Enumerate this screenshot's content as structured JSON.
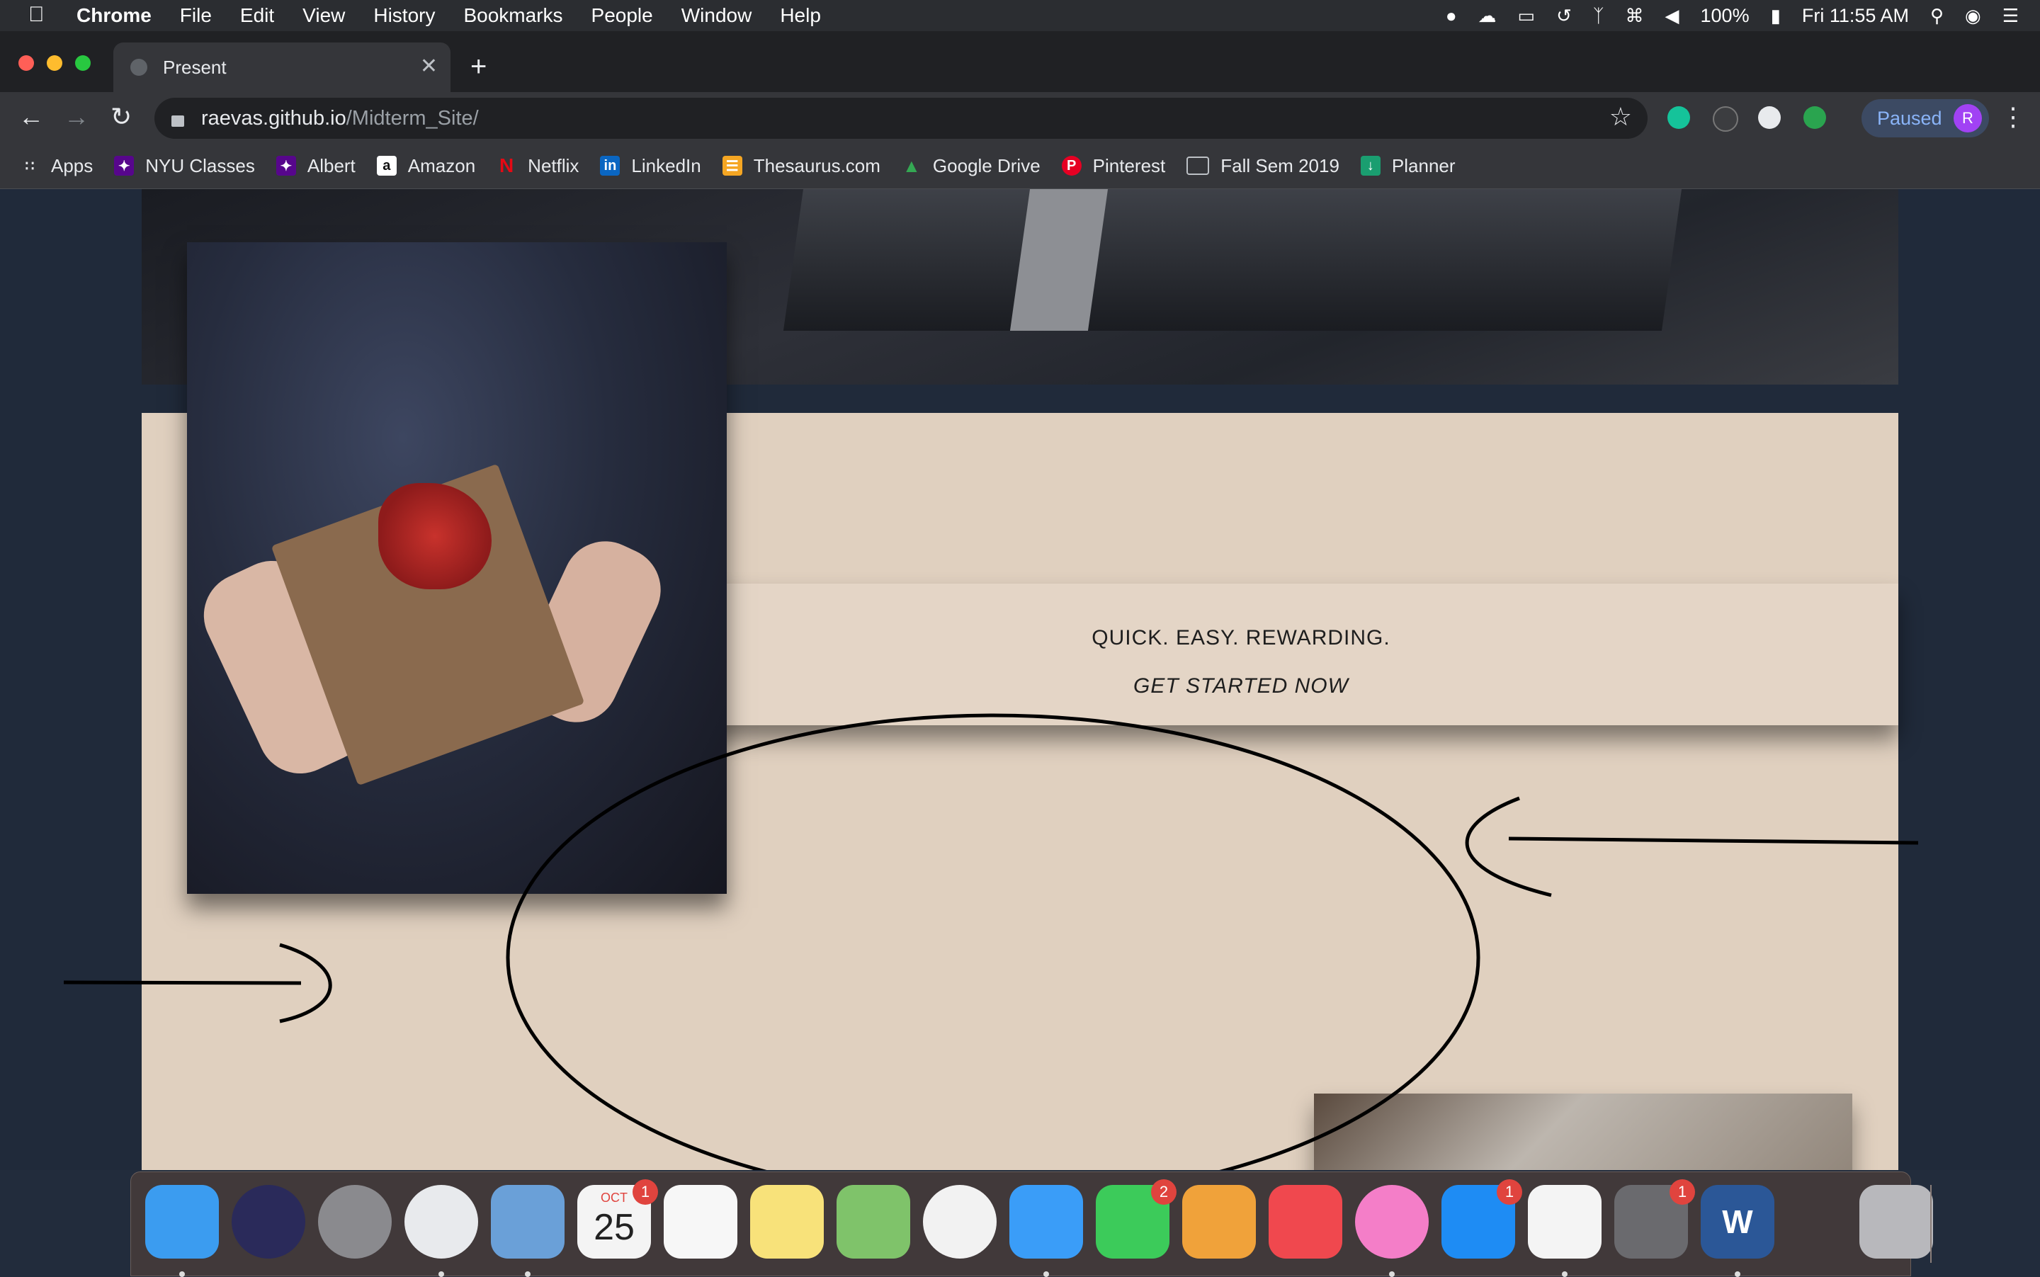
{
  "menubar": {
    "app": "Chrome",
    "menus": [
      "File",
      "Edit",
      "View",
      "History",
      "Bookmarks",
      "People",
      "Window",
      "Help"
    ],
    "battery": "100%",
    "clock": "Fri 11:55 AM"
  },
  "browser": {
    "tab_title": "Present",
    "url_host": "raevas.github.io",
    "url_path": "/Midterm_Site/",
    "profile_status": "Paused",
    "profile_initial": "R"
  },
  "bookmarks": [
    {
      "label": "Apps",
      "icon": "apps-grid-icon",
      "color": "#e8eaed"
    },
    {
      "label": "NYU Classes",
      "icon": "nyu-torch-icon",
      "color": "#57068c"
    },
    {
      "label": "Albert",
      "icon": "nyu-torch-icon",
      "color": "#57068c"
    },
    {
      "label": "Amazon",
      "icon": "amazon-icon",
      "color": "#ffffff"
    },
    {
      "label": "Netflix",
      "icon": "netflix-icon",
      "color": "#e50914"
    },
    {
      "label": "LinkedIn",
      "icon": "linkedin-icon",
      "color": "#0a66c2"
    },
    {
      "label": "Thesaurus.com",
      "icon": "thesaurus-icon",
      "color": "#f5a623"
    },
    {
      "label": "Google Drive",
      "icon": "google-drive-icon",
      "color": "#34a853"
    },
    {
      "label": "Pinterest",
      "icon": "pinterest-icon",
      "color": "#e60023"
    },
    {
      "label": "Fall Sem 2019",
      "icon": "folder-icon",
      "color": "#bdc1c6"
    },
    {
      "label": "Planner",
      "icon": "planner-icon",
      "color": "#1a9e70"
    }
  ],
  "page": {
    "tagline": "QUICK. EASY. REWARDING.",
    "cta": "GET STARTED NOW"
  },
  "dock": [
    {
      "name": "finder",
      "color": "#3b9cf0",
      "badge": "",
      "running": true
    },
    {
      "name": "siri",
      "color": "#2a2a5a",
      "badge": "",
      "running": false
    },
    {
      "name": "launchpad",
      "color": "#8a8a8e",
      "badge": "",
      "running": false
    },
    {
      "name": "chrome",
      "color": "#e8eaed",
      "badge": "",
      "running": true
    },
    {
      "name": "mail",
      "color": "#6aa0d8",
      "badge": "",
      "running": true
    },
    {
      "name": "calendar",
      "color": "#f4f4f4",
      "badge": "1",
      "running": false,
      "month": "OCT",
      "day": "25"
    },
    {
      "name": "reminders",
      "color": "#f7f7f7",
      "badge": "",
      "running": false
    },
    {
      "name": "notes",
      "color": "#f8e27a",
      "badge": "",
      "running": false
    },
    {
      "name": "maps",
      "color": "#7fc36a",
      "badge": "",
      "running": false
    },
    {
      "name": "photos",
      "color": "#f2f2f2",
      "badge": "",
      "running": false
    },
    {
      "name": "messages",
      "color": "#3a9df8",
      "badge": "",
      "running": true
    },
    {
      "name": "facetime",
      "color": "#3ccb5a",
      "badge": "2",
      "running": false
    },
    {
      "name": "pages",
      "color": "#f0a23a",
      "badge": "",
      "running": false
    },
    {
      "name": "news",
      "color": "#f0484e",
      "badge": "",
      "running": false
    },
    {
      "name": "itunes",
      "color": "#f47ec8",
      "badge": "",
      "running": true
    },
    {
      "name": "app-store",
      "color": "#1e8cf4",
      "badge": "1",
      "running": false
    },
    {
      "name": "slack",
      "color": "#f4f4f4",
      "badge": "",
      "running": true
    },
    {
      "name": "system-preferences",
      "color": "#6a6a6e",
      "badge": "1",
      "running": false
    },
    {
      "name": "word",
      "color": "#2b5797",
      "badge": "",
      "running": true,
      "glyph": "W"
    },
    {
      "name": "trash",
      "color": "#b8b8bc",
      "badge": "",
      "running": false
    }
  ]
}
